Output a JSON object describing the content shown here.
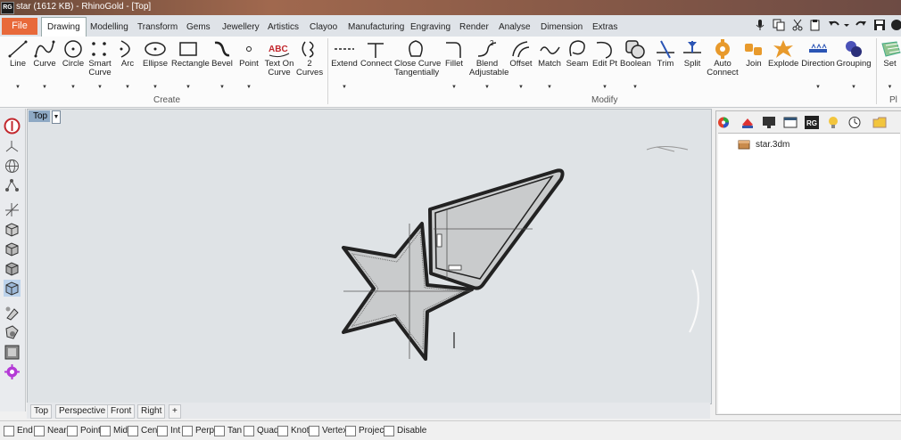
{
  "window": {
    "title": "star (1612 KB) - RhinoGold - [Top]",
    "logo": "RG"
  },
  "menu_tabs": [
    "File",
    "Drawing",
    "Modelling",
    "Transform",
    "Gems",
    "Jewellery",
    "Artistics",
    "Clayoo",
    "Manufacturing",
    "Engraving",
    "Render",
    "Analyse",
    "Dimension",
    "Extras"
  ],
  "ribbon": {
    "create_group": "Create",
    "modify_group": "Modify",
    "partial_group": "Pl",
    "create": [
      {
        "l1": "Line",
        "l2": ""
      },
      {
        "l1": "Curve",
        "l2": ""
      },
      {
        "l1": "Circle",
        "l2": ""
      },
      {
        "l1": "Smart",
        "l2": "Curve"
      },
      {
        "l1": "Arc",
        "l2": ""
      },
      {
        "l1": "Ellipse",
        "l2": ""
      },
      {
        "l1": "Rectangle",
        "l2": ""
      },
      {
        "l1": "Bevel",
        "l2": ""
      },
      {
        "l1": "Point",
        "l2": ""
      },
      {
        "l1": "Text On",
        "l2": "Curve"
      },
      {
        "l1": "2",
        "l2": "Curves"
      }
    ],
    "modify": [
      {
        "l1": "Extend",
        "l2": ""
      },
      {
        "l1": "Connect",
        "l2": ""
      },
      {
        "l1": "Close Curve",
        "l2": "Tangentially"
      },
      {
        "l1": "Fillet",
        "l2": ""
      },
      {
        "l1": "Blend",
        "l2": "Adjustable"
      },
      {
        "l1": "Offset",
        "l2": ""
      },
      {
        "l1": "Match",
        "l2": ""
      },
      {
        "l1": "Seam",
        "l2": ""
      },
      {
        "l1": "Edit Pt",
        "l2": ""
      },
      {
        "l1": "Boolean",
        "l2": ""
      },
      {
        "l1": "Trim",
        "l2": ""
      },
      {
        "l1": "Split",
        "l2": ""
      },
      {
        "l1": "Auto",
        "l2": "Connect"
      },
      {
        "l1": "Join",
        "l2": ""
      },
      {
        "l1": "Explode",
        "l2": ""
      },
      {
        "l1": "Direction",
        "l2": ""
      },
      {
        "l1": "Grouping",
        "l2": ""
      },
      {
        "l1": "Set",
        "l2": ""
      }
    ]
  },
  "viewport": {
    "label": "Top"
  },
  "viewport_tabs": [
    "Top",
    "Perspective",
    "Front",
    "Right",
    "+"
  ],
  "panel": {
    "file": "star.3dm"
  },
  "osnaps": [
    "End",
    "Near",
    "Point",
    "Mid",
    "Cen",
    "Int",
    "Perp",
    "Tan",
    "Quad",
    "Knot",
    "Vertex",
    "Project",
    "Disable"
  ],
  "colors": {
    "file_tab": "#e8693a",
    "viewport_bg": "#dfe3e6",
    "shape_fill": "#c9cbcc",
    "viewport_label": "#8ea9c4"
  }
}
